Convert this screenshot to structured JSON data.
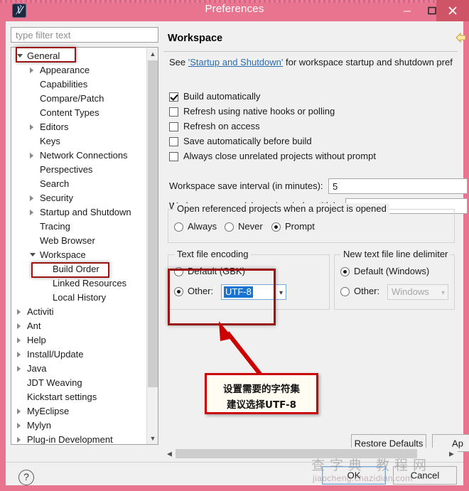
{
  "window": {
    "title": "Preferences",
    "app_icon": "eclipse-icon",
    "buttons": {
      "minimize": "minimize-icon",
      "maximize": "maximize-icon",
      "close": "close-icon"
    },
    "accent_pink": "#e8748f",
    "close_red": "#cf5566"
  },
  "filter": {
    "placeholder": "type filter text",
    "value": ""
  },
  "tree": {
    "items": [
      {
        "label": "General",
        "indent": 0,
        "arrow": "open",
        "highlighted": true
      },
      {
        "label": "Appearance",
        "indent": 1,
        "arrow": "closed",
        "highlighted": false
      },
      {
        "label": "Capabilities",
        "indent": 1,
        "arrow": "none",
        "highlighted": false
      },
      {
        "label": "Compare/Patch",
        "indent": 1,
        "arrow": "none",
        "highlighted": false
      },
      {
        "label": "Content Types",
        "indent": 1,
        "arrow": "none",
        "highlighted": false
      },
      {
        "label": "Editors",
        "indent": 1,
        "arrow": "closed",
        "highlighted": false
      },
      {
        "label": "Keys",
        "indent": 1,
        "arrow": "none",
        "highlighted": false
      },
      {
        "label": "Network Connections",
        "indent": 1,
        "arrow": "closed",
        "highlighted": false
      },
      {
        "label": "Perspectives",
        "indent": 1,
        "arrow": "none",
        "highlighted": false
      },
      {
        "label": "Search",
        "indent": 1,
        "arrow": "none",
        "highlighted": false
      },
      {
        "label": "Security",
        "indent": 1,
        "arrow": "closed",
        "highlighted": false
      },
      {
        "label": "Startup and Shutdown",
        "indent": 1,
        "arrow": "closed",
        "highlighted": false
      },
      {
        "label": "Tracing",
        "indent": 1,
        "arrow": "none",
        "highlighted": false
      },
      {
        "label": "Web Browser",
        "indent": 1,
        "arrow": "none",
        "highlighted": false
      },
      {
        "label": "Workspace",
        "indent": 1,
        "arrow": "open",
        "highlighted": true
      },
      {
        "label": "Build Order",
        "indent": 2,
        "arrow": "none",
        "highlighted": false
      },
      {
        "label": "Linked Resources",
        "indent": 2,
        "arrow": "none",
        "highlighted": false
      },
      {
        "label": "Local History",
        "indent": 2,
        "arrow": "none",
        "highlighted": false
      },
      {
        "label": "Activiti",
        "indent": 0,
        "arrow": "closed",
        "highlighted": false
      },
      {
        "label": "Ant",
        "indent": 0,
        "arrow": "closed",
        "highlighted": false
      },
      {
        "label": "Help",
        "indent": 0,
        "arrow": "closed",
        "highlighted": false
      },
      {
        "label": "Install/Update",
        "indent": 0,
        "arrow": "closed",
        "highlighted": false
      },
      {
        "label": "Java",
        "indent": 0,
        "arrow": "closed",
        "highlighted": false
      },
      {
        "label": "JDT Weaving",
        "indent": 0,
        "arrow": "none",
        "highlighted": false
      },
      {
        "label": "Kickstart settings",
        "indent": 0,
        "arrow": "none",
        "highlighted": false
      },
      {
        "label": "MyEclipse",
        "indent": 0,
        "arrow": "closed",
        "highlighted": false
      },
      {
        "label": "Mylyn",
        "indent": 0,
        "arrow": "closed",
        "highlighted": false
      },
      {
        "label": "Plug-in Development",
        "indent": 0,
        "arrow": "closed",
        "highlighted": false
      }
    ]
  },
  "page": {
    "title": "Workspace",
    "nav": {
      "back": "back-arrow-icon",
      "forward": "forward-arrow-icon"
    },
    "see_prefix": "See ",
    "see_link": "'Startup and Shutdown'",
    "see_suffix": " for workspace startup and shutdown pref",
    "checkboxes": [
      {
        "label": "Build automatically",
        "checked": true
      },
      {
        "label": "Refresh using native hooks or polling",
        "checked": false
      },
      {
        "label": "Refresh on access",
        "checked": false
      },
      {
        "label": "Save automatically before build",
        "checked": false
      },
      {
        "label": "Always close unrelated projects without prompt",
        "checked": false
      }
    ],
    "fields": [
      {
        "label": "Workspace save interval (in minutes):",
        "value": "5"
      },
      {
        "label": "Workspace name (shown in window title):",
        "value": ""
      }
    ],
    "open_referenced": {
      "legend": "Open referenced projects when a project is opened",
      "options": [
        {
          "label": "Always",
          "selected": false
        },
        {
          "label": "Never",
          "selected": false
        },
        {
          "label": "Prompt",
          "selected": true
        }
      ]
    },
    "text_file_encoding": {
      "legend": "Text file encoding",
      "default_label": "Default (GBK)",
      "default_selected": false,
      "other_label": "Other:",
      "other_selected": true,
      "other_value": "UTF-8",
      "highlighted": true
    },
    "line_delimiter": {
      "legend": "New text file line delimiter",
      "default_label": "Default (Windows)",
      "default_selected": true,
      "other_label": "Other:",
      "other_selected": false,
      "other_value": "Windows",
      "other_disabled": true
    },
    "restore_defaults": "Restore Defaults",
    "apply": "Ap"
  },
  "footer": {
    "help": "?",
    "ok": "OK",
    "cancel": "Cancel"
  },
  "annotation": {
    "line1": "设置需要的字符集",
    "line2": "建议选择UTF-8",
    "arrow_color": "#cc0000",
    "border_color": "#cc0000"
  },
  "watermark": {
    "line1": "查字典 教程网",
    "line2": "jiaocheng.chazidian.com"
  }
}
